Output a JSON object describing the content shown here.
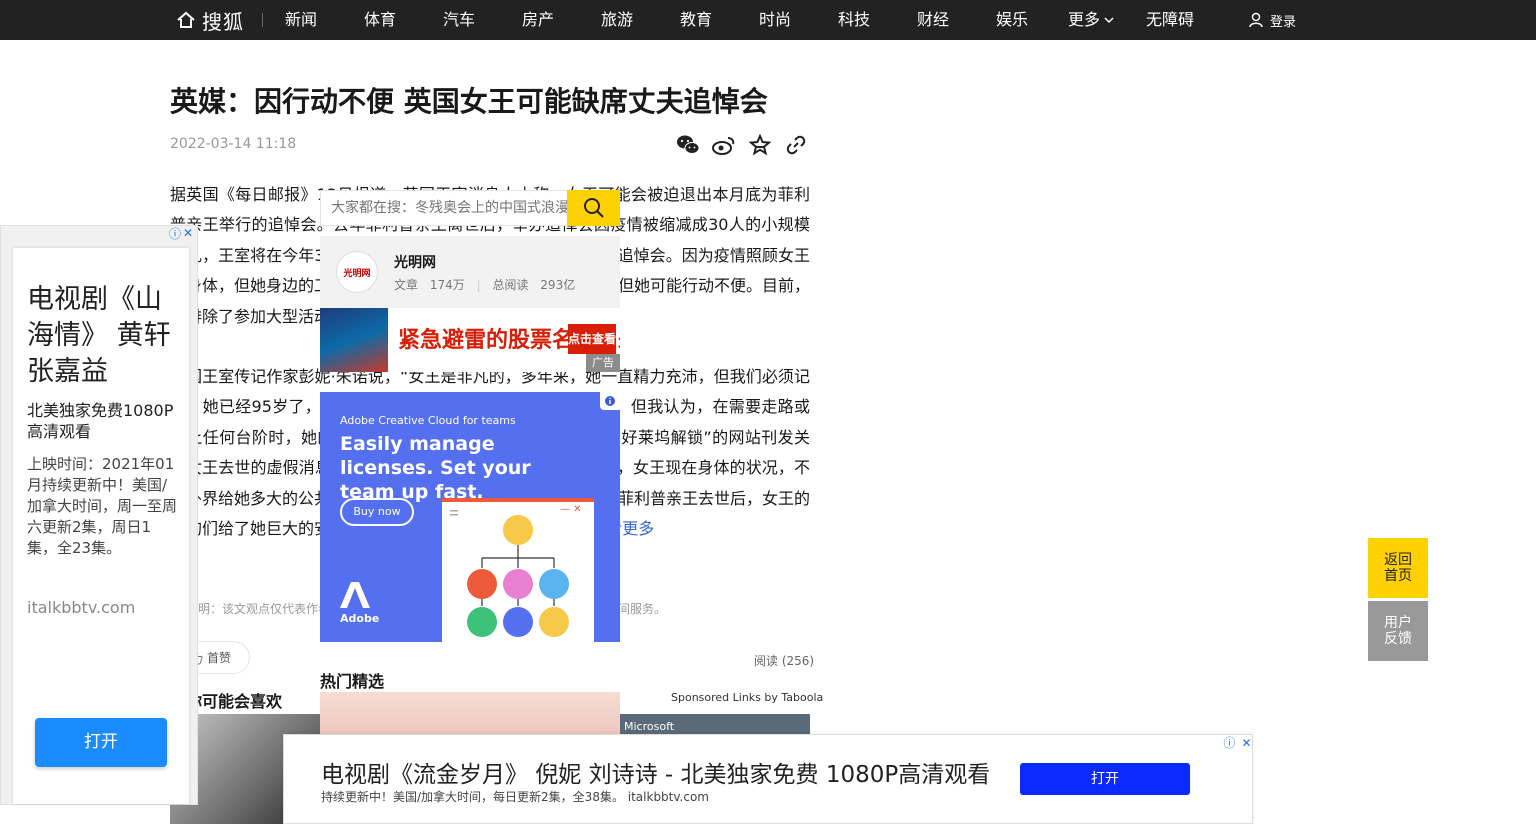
{
  "nav": {
    "logo_text": "搜狐",
    "items": [
      "新闻",
      "体育",
      "汽车",
      "房产",
      "旅游",
      "教育",
      "时尚",
      "科技",
      "财经",
      "娱乐"
    ],
    "more_label": "更多",
    "accessibility_label": "无障碍",
    "login_label": "登录"
  },
  "article": {
    "title": "英媒：因行动不便 英国女王可能缺席丈夫追悼会",
    "datetime": "2022-03-14 11:18",
    "paragraph1": "据英国《每日邮报》13日报道，英国王室消息人士称，女王可能会被迫退出本月底为菲利普亲王举行的追悼会。去年菲利普亲王离世后，举办追悼会因疫情被缩减成30人的小规模葬礼，王室将在今年3月29日于威斯敏斯特教堂举办一场隆重的追悼会。因为疫情照顾女王的身体，但她身边的工作人员表示，尽管女王非常希望能参加，但她可能行动不便。目前，她排除了参加大型活动的可能。",
    "paragraph2": "英国王室传记作家彭妮·朱诺说，“女王是非凡的，多年来，她一直精力充沛，但我们必须记住，她已经95岁了，不再是年轻人。她的精神和心态依然很好。但我认为，在需要走路或走上任何台阶时，她的身体状况就不太理想了。”美国一家名为“好莱坞解锁”的网站刊发关于女王去世的虚假消息。一名宫廷人士12日告诉英国《太阳报》，女王现在身体的状况，不管外界给她多大的公共活动压力，女王都选择外出遛狗。特别是菲利普亲王去世后，女王的狗狗们给了她巨大的安慰来源。”（环球时报）",
    "back_link": "返回搜狐，查看更多",
    "disclaimer": "声明：该文观点仅代表作者本人，搜狐号系信息发布平台，搜狐仅提供信息存储空间服务。",
    "like_label": "首赞",
    "read_count": "阅读 (256)",
    "may_like": "你可能会喜欢",
    "hot_title": "热门精选",
    "sponsored": "Sponsored Links by Taboola",
    "microsoft_label": "Microsoft"
  },
  "search": {
    "placeholder": "大家都在搜：冬残奥会上的中国式浪漫"
  },
  "author": {
    "name": "光明网",
    "avatar_text": "光明网",
    "articles_label": "文章",
    "articles_count": "174万",
    "reads_label": "总阅读",
    "reads_count": "293亿"
  },
  "ad_banner": {
    "text": "紧急避雷的股票名单出来了",
    "cta": "点击查看",
    "tag": "广告"
  },
  "ad_adobe": {
    "brand": "Adobe Creative Cloud for teams",
    "headline": "Easily manage licenses. Set your team up fast.",
    "buy": "Buy now",
    "logo_text": "Adobe"
  },
  "side_ad": {
    "title": "电视剧《山海情》 黄轩 张嘉益",
    "subtitle": "北美独家免费1080P高清观看",
    "desc": "上映时间：2021年01月持续更新中！美国/加拿大时间，周一至周六更新2集，周日1集，全23集。",
    "url": "italkbbtv.com",
    "button": "打开"
  },
  "bottom_ad": {
    "title": "电视剧《流金岁月》 倪妮 刘诗诗 - 北美独家免费 1080P高清观看",
    "desc": "持续更新中！美国/加拿大时间，每日更新2集，全38集。 italkbbtv.com",
    "button": "打开"
  },
  "float": {
    "back_top": "返回首页",
    "feedback": "用户反馈"
  },
  "colors": {
    "nav_bg": "#222222",
    "accent_yellow": "#ffd100",
    "link_blue": "#3366cc"
  }
}
